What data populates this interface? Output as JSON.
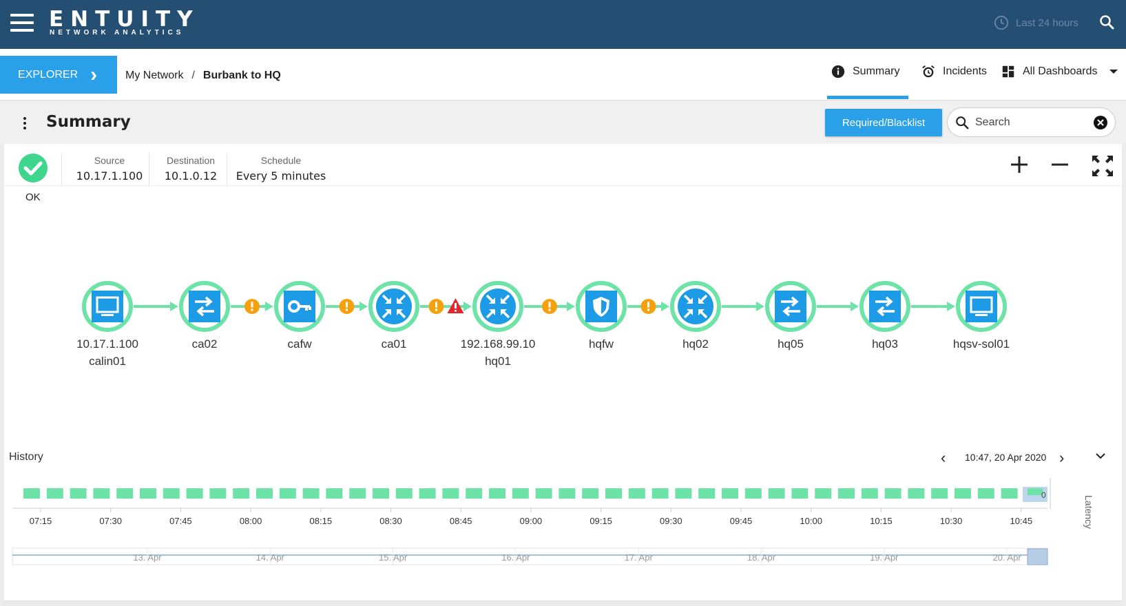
{
  "header": {
    "logo_main": "ENTUITY",
    "logo_sub": "NETWORK ANALYTICS",
    "time_range": "Last 24 hours"
  },
  "nav": {
    "explorer_label": "EXPLORER",
    "breadcrumb": [
      "My Network",
      "Burbank to HQ"
    ],
    "breadcrumb_sep": "/",
    "tabs": [
      {
        "label": "Summary",
        "icon": "info-icon",
        "active": true
      },
      {
        "label": "Incidents",
        "icon": "alarm-clock-icon"
      },
      {
        "label": "All Dashboards",
        "icon": "dashboard-grid-icon"
      }
    ]
  },
  "summary_bar": {
    "title": "Summary",
    "required_button": "Required/Blacklist",
    "search_placeholder": "Search"
  },
  "path_info": {
    "status": "OK",
    "status_color": "#3dd68c",
    "source_label": "Source",
    "source_value": "10.17.1.100",
    "destination_label": "Destination",
    "destination_value": "10.1.0.12",
    "schedule_label": "Schedule",
    "schedule_value": "Every 5 minutes"
  },
  "path": {
    "nodes": [
      {
        "type": "host",
        "line1": "10.17.1.100",
        "line2": "calin01"
      },
      {
        "type": "switch",
        "line1": "ca02",
        "line2": ""
      },
      {
        "type": "firewall-key",
        "line1": "cafw",
        "line2": ""
      },
      {
        "type": "router",
        "line1": "ca01",
        "line2": ""
      },
      {
        "type": "router",
        "line1": "192.168.99.10",
        "line2": "hq01"
      },
      {
        "type": "firewall-shield",
        "line1": "hqfw",
        "line2": ""
      },
      {
        "type": "router",
        "line1": "hq02",
        "line2": ""
      },
      {
        "type": "switch",
        "line1": "hq05",
        "line2": ""
      },
      {
        "type": "switch",
        "line1": "hq03",
        "line2": ""
      },
      {
        "type": "host",
        "line1": "hqsv-sol01",
        "line2": ""
      }
    ],
    "links": [
      {
        "warn": false,
        "alert": false
      },
      {
        "warn": true,
        "alert": false
      },
      {
        "warn": true,
        "alert": false
      },
      {
        "warn": true,
        "alert": true
      },
      {
        "warn": true,
        "alert": false
      },
      {
        "warn": true,
        "alert": false
      },
      {
        "warn": false,
        "alert": false
      },
      {
        "warn": false,
        "alert": false
      },
      {
        "warn": false,
        "alert": false
      }
    ],
    "colors": {
      "ring": "#6ee3a8",
      "icon": "#1e9be6",
      "warn": "#f5a00f",
      "alert": "#e0282d"
    }
  },
  "history": {
    "title": "History",
    "date": "10:47, 20 Apr 2020",
    "latency_label": "Latency",
    "latency_value": "0",
    "time_ticks": [
      "07:15",
      "07:30",
      "07:45",
      "08:00",
      "08:15",
      "08:30",
      "08:45",
      "09:00",
      "09:15",
      "09:30",
      "09:45",
      "10:00",
      "10:15",
      "10:30",
      "10:45"
    ],
    "day_ticks": [
      "13. Apr",
      "14. Apr",
      "15. Apr",
      "16. Apr",
      "17. Apr",
      "18. Apr",
      "19. Apr",
      "20. Apr"
    ],
    "status_blocks": 43,
    "block_color": "#6ee3a8"
  }
}
